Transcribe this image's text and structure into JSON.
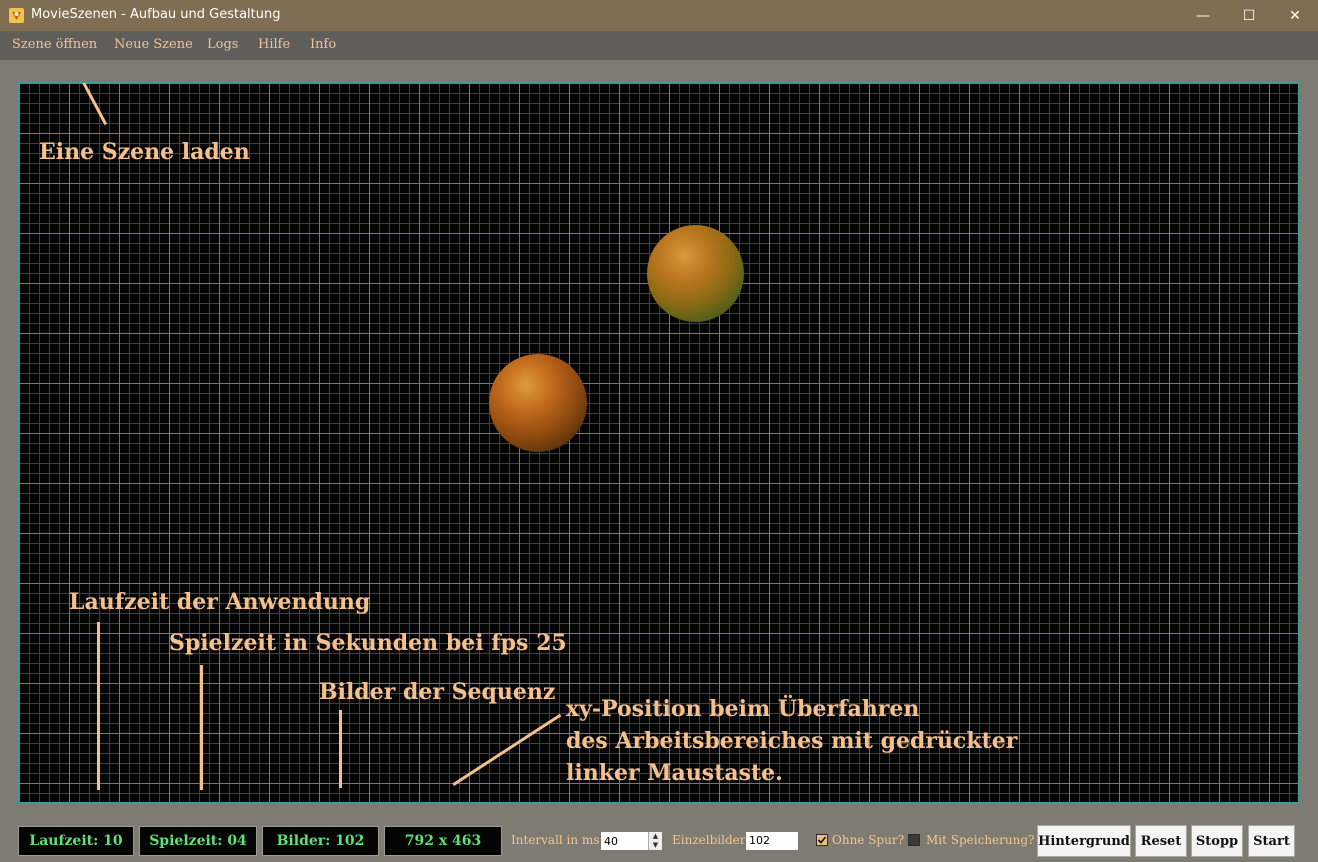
{
  "window": {
    "title": "MovieSzenen - Aufbau und Gestaltung",
    "controls": {
      "minimize": "—",
      "maximize": "☐",
      "close": "✕"
    }
  },
  "menu": {
    "items": [
      "Szene öffnen",
      "Neue Szene",
      "Logs",
      "Hilfe",
      "Info"
    ]
  },
  "canvas": {
    "annotations": {
      "load_scene": "Eine Szene laden",
      "runtime": "Laufzeit der Anwendung",
      "playtime": "Spielzeit in Sekunden bei fps 25",
      "frames": "Bilder der Sequenz",
      "xy_line1": "xy-Position beim Überfahren",
      "xy_line2": "des Arbeitsbereiches mit gedrückter",
      "xy_line3": "linker Maustaste."
    }
  },
  "status": {
    "runtime": "Laufzeit: 10",
    "playtime": "Spielzeit: 04",
    "frames": "Bilder: 102",
    "size": "792 x 463",
    "interval_label": "Intervall in ms:",
    "interval_value": "40",
    "single_frames_label": "Einzelbilder:",
    "single_frames_value": "102",
    "no_trace_label": "Ohne Spur?",
    "no_trace_checked": true,
    "with_save_label": "Mit Speicherung?",
    "with_save_checked": false
  },
  "buttons": {
    "background": "Hintergrund",
    "reset": "Reset",
    "stop": "Stopp",
    "start": "Start"
  },
  "colors": {
    "annotation": "#f4c08c",
    "menu_text": "#f1c592",
    "counter_text": "#5fe07a",
    "grid_major": "#3e9ea0",
    "titlebar": "#7f6e51"
  }
}
